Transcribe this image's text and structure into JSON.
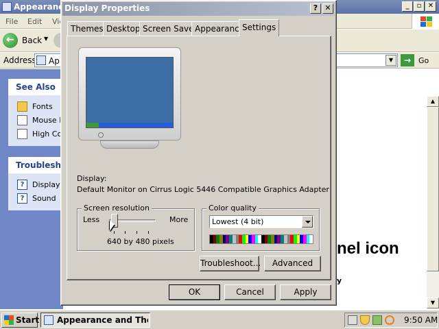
{
  "background_window": {
    "title": "Appearance",
    "menu": [
      "File",
      "Edit",
      "Vie"
    ],
    "back_label": "Back",
    "address_label": "Address",
    "address_value": "App",
    "go_label": "Go",
    "see_also": {
      "title": "See Also",
      "items": [
        "Fonts",
        "Mouse P",
        "High Cor"
      ]
    },
    "troubleshooters": {
      "title": "Troublesho",
      "items": [
        "Display",
        "Sound"
      ]
    },
    "content_heading": "nel icon",
    "content_fragment": "y"
  },
  "dialog": {
    "title": "Display Properties",
    "help_glyph": "?",
    "close_glyph": "✕",
    "tabs": [
      "Themes",
      "Desktop",
      "Screen Saver",
      "Appearance",
      "Settings"
    ],
    "active_tab": "Settings",
    "display_label": "Display:",
    "display_value": "Default Monitor on Cirrus Logic 5446 Compatible Graphics Adapter",
    "screen_resolution": {
      "title": "Screen resolution",
      "less": "Less",
      "more": "More",
      "value": "640 by 480 pixels",
      "slider_level": 0
    },
    "color_quality": {
      "title": "Color quality",
      "selected": "Lowest (4 bit)",
      "palette": [
        "#000000",
        "#800000",
        "#008000",
        "#808000",
        "#000080",
        "#800080",
        "#008080",
        "#c0c0c0",
        "#808080",
        "#ff0000",
        "#00ff00",
        "#ffff00",
        "#0000ff",
        "#ff00ff",
        "#00ffff",
        "#ffffff",
        "#000000",
        "#800000",
        "#008000",
        "#808000",
        "#000080",
        "#800080",
        "#008080",
        "#c0c0c0",
        "#808080",
        "#ff0000",
        "#00ff00",
        "#ffff00",
        "#0000ff",
        "#ff00ff",
        "#00ffff",
        "#ffffff"
      ]
    },
    "troubleshoot_label": "Troubleshoot...",
    "advanced_label": "Advanced",
    "ok_label": "OK",
    "cancel_label": "Cancel",
    "apply_label": "Apply"
  },
  "taskbar": {
    "start_label": "Start",
    "task_label": "Appearance and The...",
    "clock": "9:50 AM"
  }
}
